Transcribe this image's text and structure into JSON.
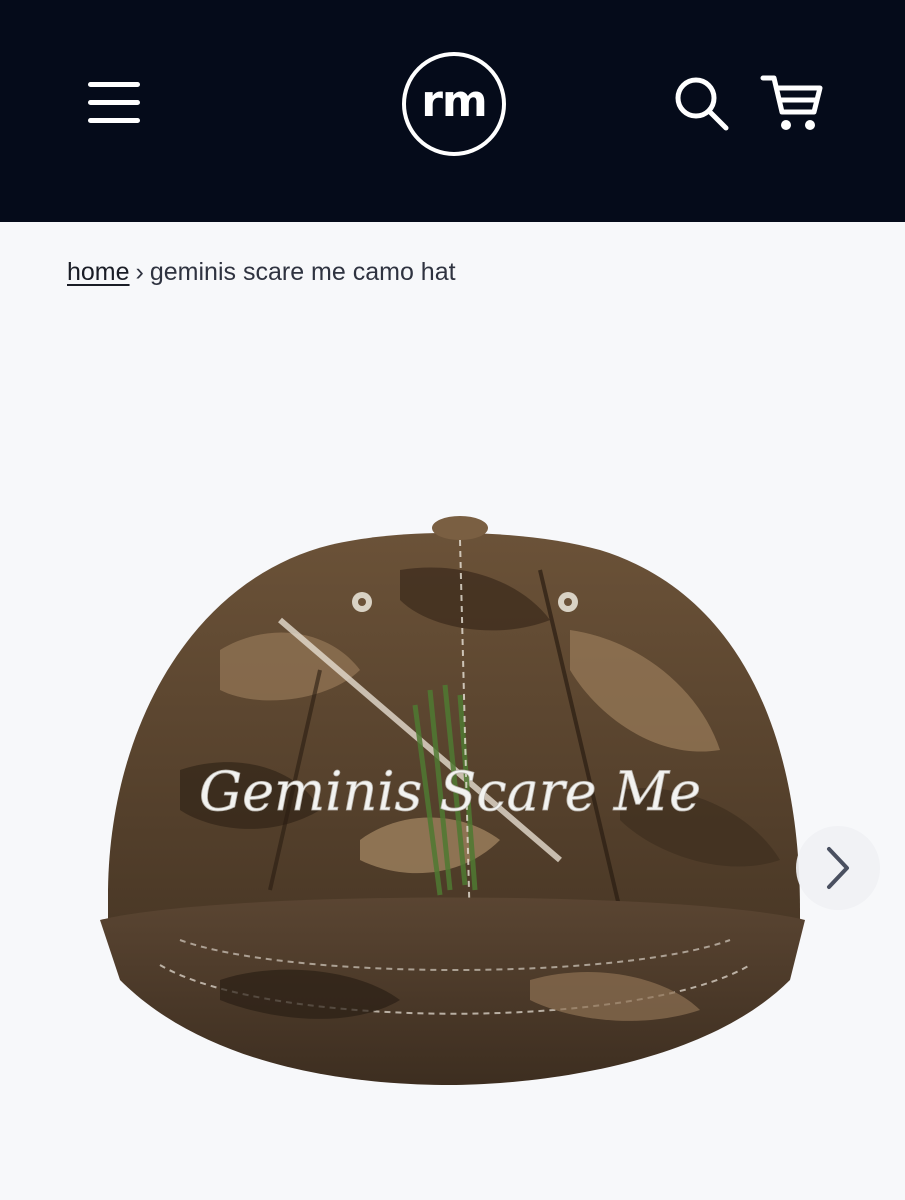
{
  "header": {
    "logo_text": "rm",
    "menu_icon": "hamburger-menu-icon",
    "search_icon": "search-icon",
    "cart_icon": "shopping-cart-icon",
    "background_color": "#050b1a"
  },
  "breadcrumb": {
    "home_label": "home",
    "separator": "›",
    "current": "geminis scare me camo hat"
  },
  "product": {
    "image_embroidery_text": "Geminis Scare Me"
  },
  "carousel": {
    "next_icon": "chevron-right-icon"
  }
}
